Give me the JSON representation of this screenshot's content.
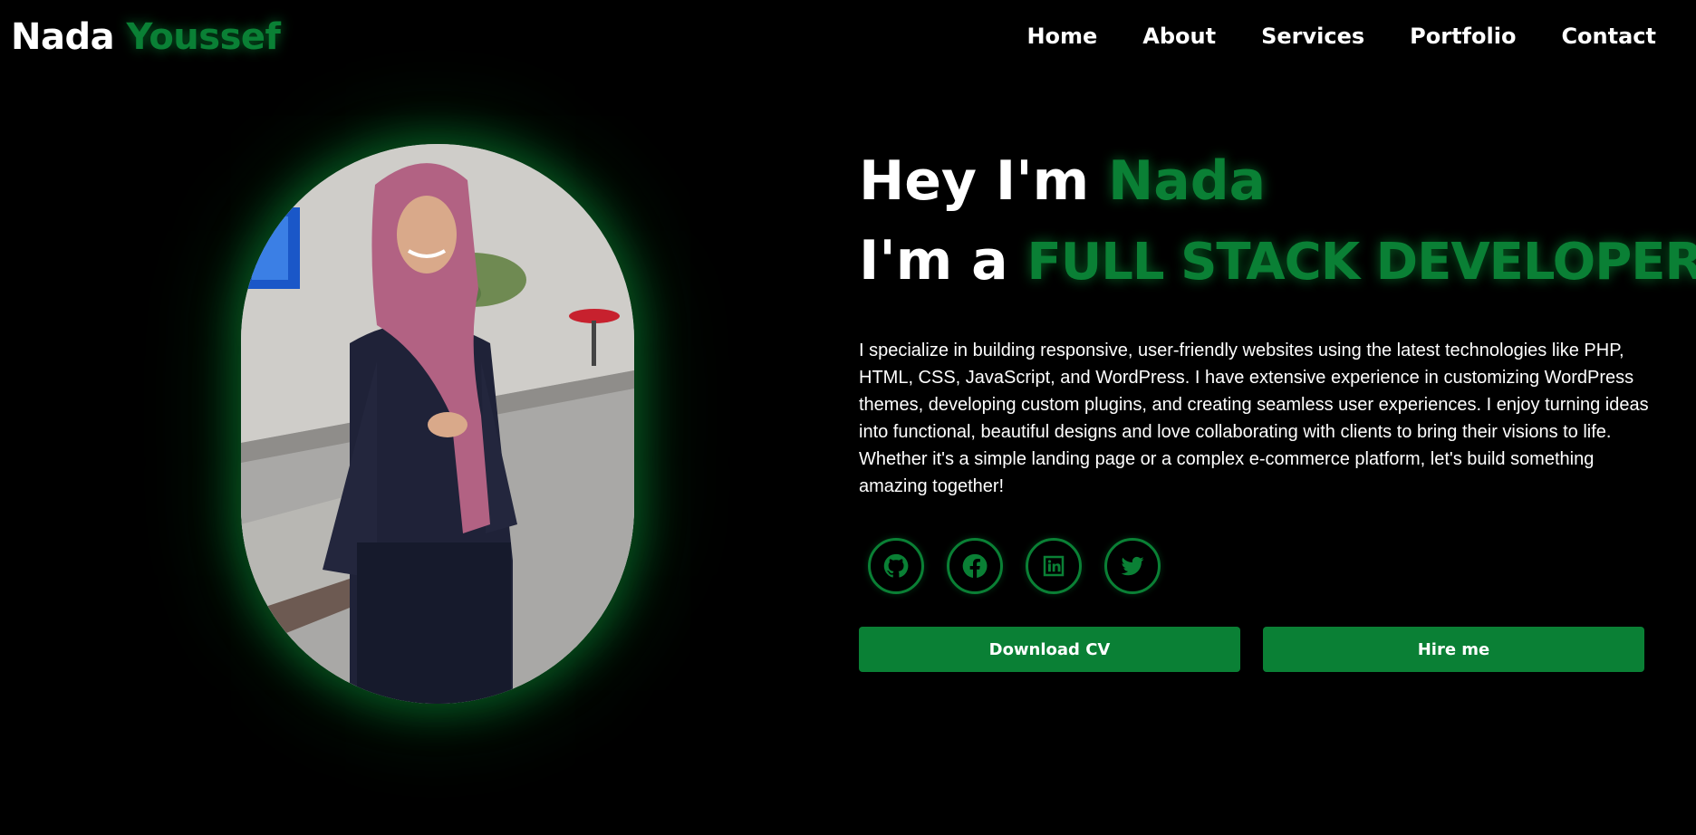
{
  "header": {
    "logo_first": "Nada",
    "logo_last": "Youssef",
    "nav": [
      "Home",
      "About",
      "Services",
      "Portfolio",
      "Contact"
    ]
  },
  "hero": {
    "greeting": "Hey I'm",
    "name": "Nada",
    "role_prefix": "I'm a",
    "role": "FULL STACK DEVELOPER",
    "cursor": "|",
    "bio": "I specialize in building responsive, user-friendly websites using the latest technologies like PHP, HTML, CSS, JavaScript, and WordPress. I have extensive experience in customizing WordPress themes, developing custom plugins, and creating seamless user experiences. I enjoy turning ideas into functional, beautiful designs and love collaborating with clients to bring their visions to life. Whether it's a simple landing page or a complex e-commerce platform, let's build something amazing together!",
    "socials": [
      "github-icon",
      "facebook-icon",
      "linkedin-icon",
      "twitter-icon"
    ],
    "buttons": {
      "download": "Download CV",
      "hire": "Hire me"
    }
  },
  "colors": {
    "accent": "#0a8035",
    "background": "#000000",
    "text": "#ffffff"
  }
}
